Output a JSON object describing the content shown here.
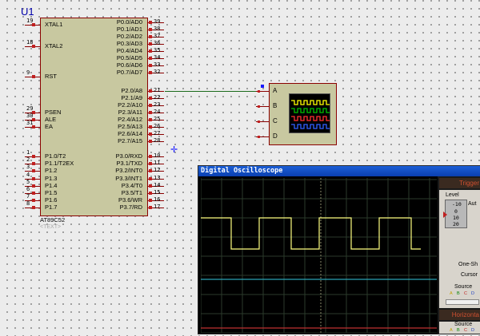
{
  "schematic": {
    "chip": {
      "ref": "U1",
      "name": "AT89C52",
      "placeholder_text": "<TEXT>",
      "left_pins": [
        {
          "num": "19",
          "label": "XTAL1"
        },
        {
          "num": "18",
          "label": "XTAL2"
        },
        {
          "num": "9",
          "label": "RST"
        },
        {
          "num": "29",
          "label": "PSEN"
        },
        {
          "num": "30",
          "label": "ALE"
        },
        {
          "num": "31",
          "label": "EA"
        },
        {
          "num": "1",
          "label": "P1.0/T2"
        },
        {
          "num": "2",
          "label": "P1.1/T2EX"
        },
        {
          "num": "3",
          "label": "P1.2"
        },
        {
          "num": "4",
          "label": "P1.3"
        },
        {
          "num": "5",
          "label": "P1.4"
        },
        {
          "num": "6",
          "label": "P1.5"
        },
        {
          "num": "7",
          "label": "P1.6"
        },
        {
          "num": "8",
          "label": "P1.7"
        }
      ],
      "right_pins": [
        {
          "num": "39",
          "label": "P0.0/AD0"
        },
        {
          "num": "38",
          "label": "P0.1/AD1"
        },
        {
          "num": "37",
          "label": "P0.2/AD2"
        },
        {
          "num": "36",
          "label": "P0.3/AD3"
        },
        {
          "num": "35",
          "label": "P0.4/AD4"
        },
        {
          "num": "34",
          "label": "P0.5/AD5"
        },
        {
          "num": "33",
          "label": "P0.6/AD6"
        },
        {
          "num": "32",
          "label": "P0.7/AD7"
        },
        {
          "num": "21",
          "label": "P2.0/A8"
        },
        {
          "num": "22",
          "label": "P2.1/A9"
        },
        {
          "num": "23",
          "label": "P2.2/A10"
        },
        {
          "num": "24",
          "label": "P2.3/A11"
        },
        {
          "num": "25",
          "label": "P2.4/A12"
        },
        {
          "num": "26",
          "label": "P2.5/A13"
        },
        {
          "num": "27",
          "label": "P2.6/A14"
        },
        {
          "num": "28",
          "label": "P2.7/A15"
        },
        {
          "num": "10",
          "label": "P3.0/RXD"
        },
        {
          "num": "11",
          "label": "P3.1/TXD"
        },
        {
          "num": "12",
          "label": "P3.2/INT0"
        },
        {
          "num": "13",
          "label": "P3.3/INT1"
        },
        {
          "num": "14",
          "label": "P3.4/T0"
        },
        {
          "num": "15",
          "label": "P3.5/T1"
        },
        {
          "num": "16",
          "label": "P3.6/WR"
        },
        {
          "num": "17",
          "label": "P3.7/RD"
        }
      ]
    },
    "scope_symbol": {
      "channels": [
        "A",
        "B",
        "C",
        "D"
      ],
      "trace_colors": [
        "#ffff00",
        "#00c000",
        "#ff3030",
        "#3060ff"
      ]
    }
  },
  "oscilloscope_window": {
    "title": "Digital Oscilloscope",
    "trigger_header": "Trigger",
    "level_label": "Level",
    "knob_ticks": [
      "-10",
      "0",
      "10",
      "20"
    ],
    "auto_label": "Aut",
    "one_shot_label": "One-Sh",
    "cursors_label": "Cursor",
    "source_label": "Source",
    "source_letters": [
      "A",
      "B",
      "C",
      "D"
    ],
    "horizontal_header": "Horizonta",
    "source_label_2": "Source",
    "colors": {
      "channel_a": "#ffff80",
      "channel_b": "#2aa3b5",
      "channel_c": "#c03030",
      "grid": "#2b3a2b",
      "background": "#000000",
      "titlebar": "#0a3fb0"
    }
  }
}
